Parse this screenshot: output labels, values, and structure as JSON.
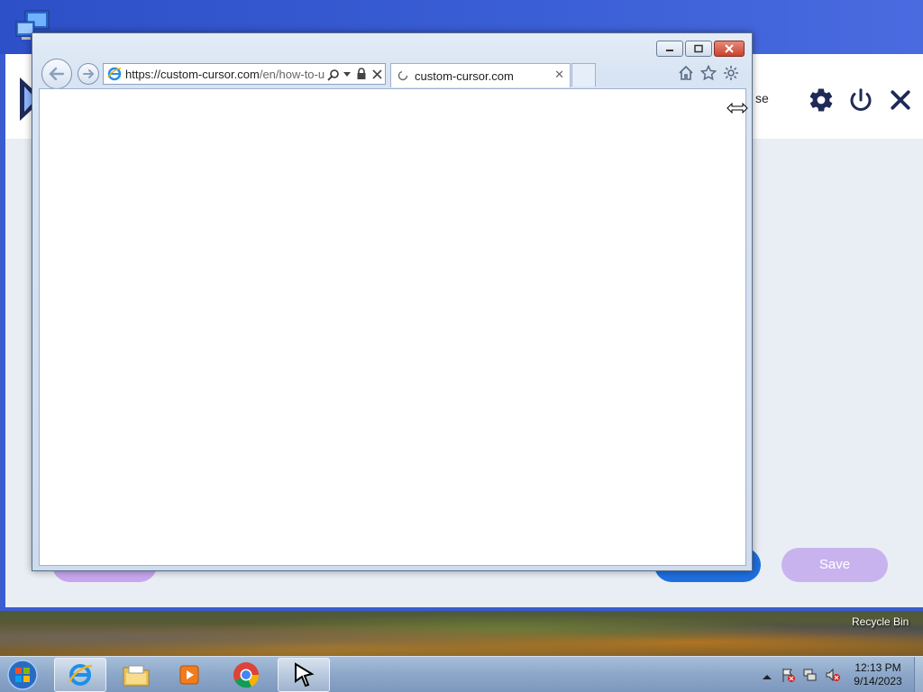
{
  "desktop": {
    "recycle_bin_label": "Recycle Bin"
  },
  "background_app": {
    "header_partial_text": "se",
    "save_label": "Save",
    "colors": {
      "save_pill": "#c9b3ef",
      "left_pill": "#c7a6ee",
      "blue_pill": "#1e6fe0",
      "icon": "#1f2a57"
    }
  },
  "browser": {
    "address_host": "https://custom-cursor.com",
    "address_path": "/en/how-to-u",
    "tab_title": "custom-cursor.com"
  },
  "taskbar": {
    "time": "12:13 PM",
    "date": "9/14/2023",
    "apps": [
      "internet-explorer",
      "file-explorer",
      "media-player",
      "chrome",
      "custom-cursor"
    ]
  }
}
